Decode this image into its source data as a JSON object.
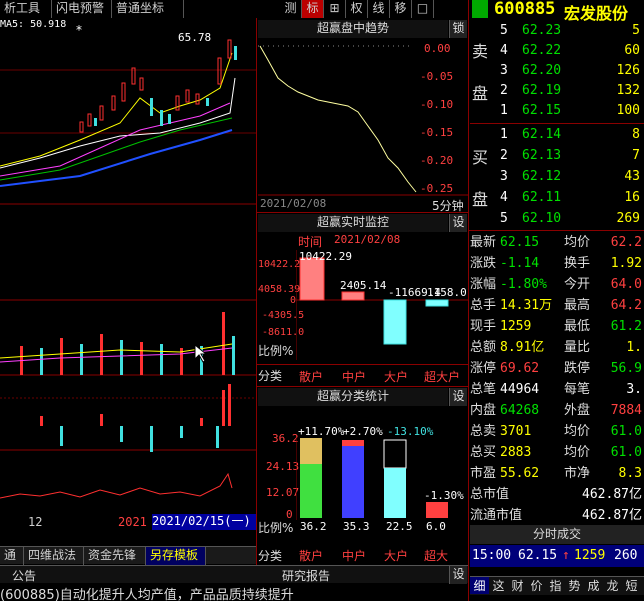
{
  "toolbar": {
    "left": [
      "析工具",
      "闪电预警",
      "普通坐标"
    ],
    "right_buttons": [
      "测",
      "标",
      "⊞",
      "权",
      "线",
      "移",
      "□"
    ]
  },
  "stock": {
    "code": "600885",
    "name": "宏发股份"
  },
  "kline": {
    "ma_label": "MA5: 50.918",
    "high_label": "65.78",
    "date_labels": [
      "12",
      "2021",
      "2021/02/15(一)"
    ]
  },
  "trend_panel": {
    "title": "超赢盘中趋势",
    "lock_label": "锁",
    "y_labels": [
      "0.00",
      "-0.05",
      "-0.10",
      "-0.15",
      "-0.20",
      "-0.25"
    ],
    "x_label": "2021/02/08",
    "period": "5分钟"
  },
  "monitor_panel": {
    "title": "超赢实时监控",
    "set_label": "设",
    "time_label": "时间",
    "date": "2021/02/08",
    "y_labels": [
      "10422.29",
      "4058.39",
      "0",
      "-4305.5",
      "-8611.0"
    ],
    "ratio_label": "比例%",
    "bar_values": [
      "10422.29",
      "2405.14",
      "-11669.4",
      "1158.0"
    ],
    "categories_label": "分类",
    "categories": [
      "散户",
      "中户",
      "大户",
      "超大户"
    ]
  },
  "category_panel": {
    "title": "超赢分类统计",
    "set_label": "设",
    "y_labels": [
      "36.2",
      "24.13",
      "12.07",
      "0"
    ],
    "pct_labels": [
      "+11.70%",
      "+2.70%",
      "-13.10%",
      "-1.30%"
    ],
    "ratio_label": "比例%",
    "values": [
      "36.2",
      "35.3",
      "22.5",
      "6.0"
    ],
    "categories_label": "分类",
    "categories": [
      "散户",
      "中户",
      "大户",
      "超大"
    ]
  },
  "bottom_tabs": [
    "通",
    "四维战法",
    "资金先锋",
    "另存模板"
  ],
  "news": {
    "tabs": [
      "公告",
      "研究报告"
    ],
    "set_label": "设",
    "ticker": "(600885)自动化提升人均产值，产品品质持续提升"
  },
  "order_book": {
    "sell_label": [
      "卖",
      "盘"
    ],
    "buy_label": [
      "买",
      "盘"
    ],
    "asks": [
      {
        "level": "5",
        "price": "62.23",
        "volume": "5"
      },
      {
        "level": "4",
        "price": "62.22",
        "volume": "60"
      },
      {
        "level": "3",
        "price": "62.20",
        "volume": "126"
      },
      {
        "level": "2",
        "price": "62.19",
        "volume": "132"
      },
      {
        "level": "1",
        "price": "62.15",
        "volume": "100"
      }
    ],
    "bids": [
      {
        "level": "1",
        "price": "62.14",
        "volume": "8"
      },
      {
        "level": "2",
        "price": "62.13",
        "volume": "7"
      },
      {
        "level": "3",
        "price": "62.12",
        "volume": "43"
      },
      {
        "level": "4",
        "price": "62.11",
        "volume": "16"
      },
      {
        "level": "5",
        "price": "62.10",
        "volume": "269"
      }
    ]
  },
  "stats": [
    {
      "l1": "最新",
      "v1": "62.15",
      "c1": "green",
      "l2": "均价",
      "v2": "62.2",
      "c2": "red"
    },
    {
      "l1": "涨跌",
      "v1": "-1.14",
      "c1": "green",
      "l2": "换手",
      "v2": "1.92",
      "c2": "yellow"
    },
    {
      "l1": "涨幅",
      "v1": "-1.80%",
      "c1": "green",
      "l2": "今开",
      "v2": "64.0",
      "c2": "red"
    },
    {
      "l1": "总手",
      "v1": "14.31万",
      "c1": "yellow",
      "l2": "最高",
      "v2": "64.2",
      "c2": "red"
    },
    {
      "l1": "现手",
      "v1": "1259",
      "c1": "yellow",
      "l2": "最低",
      "v2": "61.2",
      "c2": "green"
    },
    {
      "l1": "总额",
      "v1": "8.91亿",
      "c1": "yellow",
      "l2": "量比",
      "v2": "1.",
      "c2": "yellow"
    },
    {
      "l1": "涨停",
      "v1": "69.62",
      "c1": "red",
      "l2": "跌停",
      "v2": "56.9",
      "c2": "green"
    },
    {
      "l1": "总笔",
      "v1": "44964",
      "c1": "white",
      "l2": "每笔",
      "v2": "3.",
      "c2": "white"
    },
    {
      "l1": "内盘",
      "v1": "64268",
      "c1": "green",
      "l2": "外盘",
      "v2": "7884",
      "c2": "red"
    },
    {
      "l1": "总卖",
      "v1": "3701",
      "c1": "yellow",
      "l2": "均价",
      "v2": "61.0",
      "c2": "green"
    },
    {
      "l1": "总买",
      "v1": "2883",
      "c1": "yellow",
      "l2": "均价",
      "v2": "61.0",
      "c2": "green"
    },
    {
      "l1": "市盈",
      "v1": "55.62",
      "c1": "yellow",
      "l2": "市净",
      "v2": "8.3",
      "c2": "yellow"
    }
  ],
  "market_value": [
    {
      "label": "总市值",
      "value": "462.87亿"
    },
    {
      "label": "流通市值",
      "value": "462.87亿"
    }
  ],
  "ticks": {
    "title": "分时成交",
    "row": {
      "time": "15:00",
      "price": "62.15",
      "arrow": "↑",
      "volume": "1259",
      "count": "260"
    }
  },
  "bottom_right_tabs": [
    "细",
    "这",
    "财",
    "价",
    "指",
    "势",
    "成",
    "龙",
    "短"
  ]
}
